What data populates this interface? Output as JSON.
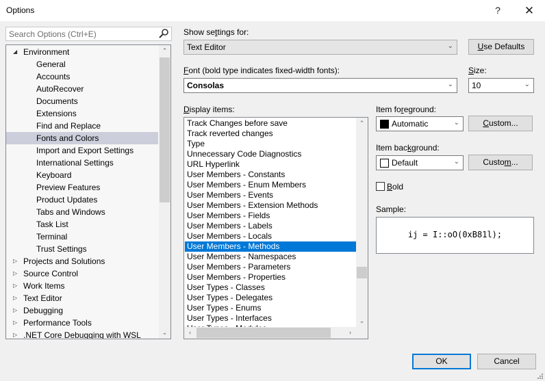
{
  "window": {
    "title": "Options",
    "help_label": "?",
    "close_label": "✕"
  },
  "search": {
    "placeholder": "Search Options (Ctrl+E)",
    "icon": "search-icon"
  },
  "tree": {
    "items": [
      {
        "label": "Environment",
        "level": 0,
        "state": "expanded"
      },
      {
        "label": "General",
        "level": 1
      },
      {
        "label": "Accounts",
        "level": 1
      },
      {
        "label": "AutoRecover",
        "level": 1
      },
      {
        "label": "Documents",
        "level": 1
      },
      {
        "label": "Extensions",
        "level": 1
      },
      {
        "label": "Find and Replace",
        "level": 1
      },
      {
        "label": "Fonts and Colors",
        "level": 1,
        "selected": true
      },
      {
        "label": "Import and Export Settings",
        "level": 1
      },
      {
        "label": "International Settings",
        "level": 1
      },
      {
        "label": "Keyboard",
        "level": 1
      },
      {
        "label": "Preview Features",
        "level": 1
      },
      {
        "label": "Product Updates",
        "level": 1
      },
      {
        "label": "Tabs and Windows",
        "level": 1
      },
      {
        "label": "Task List",
        "level": 1
      },
      {
        "label": "Terminal",
        "level": 1
      },
      {
        "label": "Trust Settings",
        "level": 1
      },
      {
        "label": "Projects and Solutions",
        "level": 0,
        "state": "collapsed"
      },
      {
        "label": "Source Control",
        "level": 0,
        "state": "collapsed"
      },
      {
        "label": "Work Items",
        "level": 0,
        "state": "collapsed"
      },
      {
        "label": "Text Editor",
        "level": 0,
        "state": "collapsed"
      },
      {
        "label": "Debugging",
        "level": 0,
        "state": "collapsed"
      },
      {
        "label": "Performance Tools",
        "level": 0,
        "state": "collapsed"
      },
      {
        "label": ".NET Core Debugging with WSL",
        "level": 0,
        "state": "collapsed"
      }
    ]
  },
  "settings": {
    "show_settings_for_label_pre": "Show se",
    "show_settings_for_label_key": "t",
    "show_settings_for_label_post": "tings for:",
    "show_settings_for_value": "Text Editor",
    "use_defaults_key": "U",
    "use_defaults_rest": "se Defaults",
    "font_label_key": "F",
    "font_label_rest": "ont (bold type indicates fixed-width fonts):",
    "font_value": "Consolas",
    "size_label_key": "S",
    "size_label_rest": "ize:",
    "size_value": "10"
  },
  "display_items": {
    "label_key": "D",
    "label_rest": "isplay items:",
    "items": [
      "Track Changes before save",
      "Track reverted changes",
      "Type",
      "Unnecessary Code Diagnostics",
      "URL Hyperlink",
      "User Members - Constants",
      "User Members - Enum Members",
      "User Members - Events",
      "User Members - Extension Methods",
      "User Members - Fields",
      "User Members - Labels",
      "User Members - Locals",
      "User Members - Methods",
      "User Members - Namespaces",
      "User Members - Parameters",
      "User Members - Properties",
      "User Types - Classes",
      "User Types - Delegates",
      "User Types - Enums",
      "User Types - Interfaces",
      "User Types - Modules"
    ],
    "selected": "User Members - Methods"
  },
  "foreground": {
    "label_pre": "Item fo",
    "label_key": "r",
    "label_post": "eground:",
    "value": "Automatic",
    "swatch_color": "#000000",
    "custom_pre": "",
    "custom_key": "C",
    "custom_post": "ustom..."
  },
  "background": {
    "label_pre": "Item bac",
    "label_key": "k",
    "label_post": "ground:",
    "value": "Default",
    "swatch_color": "#ffffff",
    "custom_pre": "Custo",
    "custom_key": "m",
    "custom_post": "..."
  },
  "bold": {
    "key": "B",
    "rest": "old",
    "checked": false
  },
  "sample": {
    "label": "Sample:",
    "code": "ij = I::oO(0xB81l);"
  },
  "footer": {
    "ok_label": "OK",
    "cancel_label": "Cancel"
  },
  "colors": {
    "accent": "#0078d7",
    "tree_selection": "#cccedb"
  }
}
